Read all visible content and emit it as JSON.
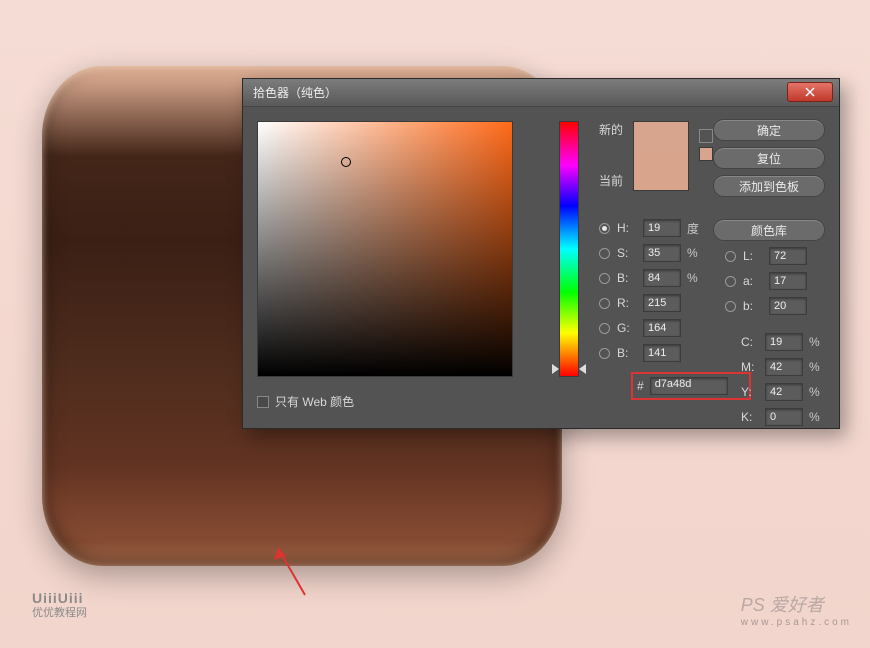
{
  "dialog": {
    "title": "拾色器（纯色）",
    "buttons": {
      "ok": "确定",
      "reset": "复位",
      "addSwatch": "添加到色板",
      "library": "颜色库"
    },
    "swatch": {
      "newLabel": "新的",
      "currentLabel": "当前",
      "newColor": "#d7a48d",
      "currentColor": "#d9a48c"
    },
    "webOnly": "只有 Web 颜色",
    "hsb": {
      "hLabel": "H:",
      "h": "19",
      "hUnit": "度",
      "sLabel": "S:",
      "s": "35",
      "sUnit": "%",
      "bLabel": "B:",
      "b": "84",
      "bUnit": "%"
    },
    "lab": {
      "lLabel": "L:",
      "l": "72",
      "aLabel": "a:",
      "a": "17",
      "bLabel": "b:",
      "b": "20"
    },
    "rgb": {
      "rLabel": "R:",
      "r": "215",
      "gLabel": "G:",
      "g": "164",
      "bLabel": "B:",
      "b": "141"
    },
    "cmyk": {
      "cLabel": "C:",
      "c": "19",
      "unit": "%",
      "mLabel": "M:",
      "m": "42",
      "yLabel": "Y:",
      "y": "42",
      "kLabel": "K:",
      "k": "0"
    },
    "hexLabel": "#",
    "hex": "d7a48d"
  },
  "watermarks": {
    "leftLogo": "UiiiUiii",
    "leftSub": "优优教程网",
    "rightMain": "PS 爱好者",
    "rightSub": "www.psahz.com"
  }
}
